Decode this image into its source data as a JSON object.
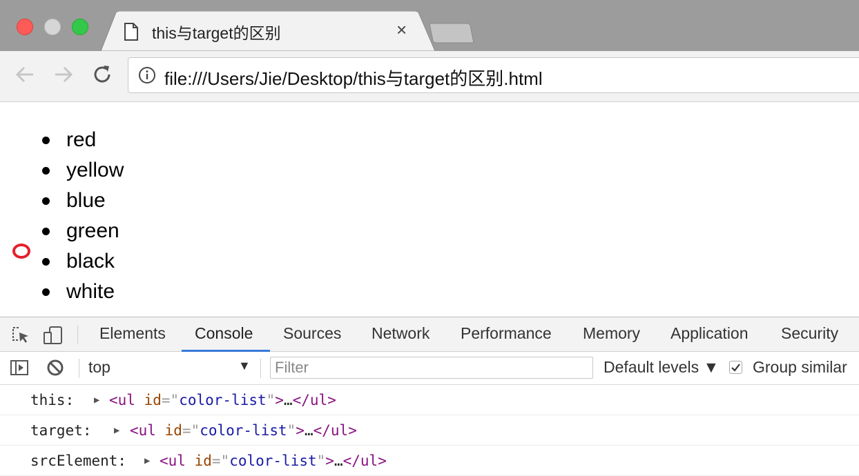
{
  "browser": {
    "tab": {
      "title": "this与target的区别",
      "close": "×"
    },
    "address_bar": {
      "url": "file:///Users/Jie/Desktop/this与target的区别.html"
    }
  },
  "page": {
    "colors": [
      "red",
      "yellow",
      "blue",
      "green",
      "black",
      "white"
    ]
  },
  "devtools": {
    "tabs": [
      "Elements",
      "Console",
      "Sources",
      "Network",
      "Performance",
      "Memory",
      "Application",
      "Security"
    ],
    "active_tab": "Console",
    "console_bar": {
      "context": "top",
      "filter_placeholder": "Filter",
      "levels": "Default levels ▼",
      "group_similar": "Group similar",
      "group_similar_checked": true
    },
    "console_lines": [
      {
        "label": "this:",
        "tag": "ul",
        "attr_name": "id",
        "attr_value": "color-list",
        "ellipsis": "…"
      },
      {
        "label": "target:",
        "tag": "ul",
        "attr_name": "id",
        "attr_value": "color-list",
        "ellipsis": "…"
      },
      {
        "label": "srcElement:",
        "tag": "ul",
        "attr_name": "id",
        "attr_value": "color-list",
        "ellipsis": "…"
      }
    ]
  }
}
